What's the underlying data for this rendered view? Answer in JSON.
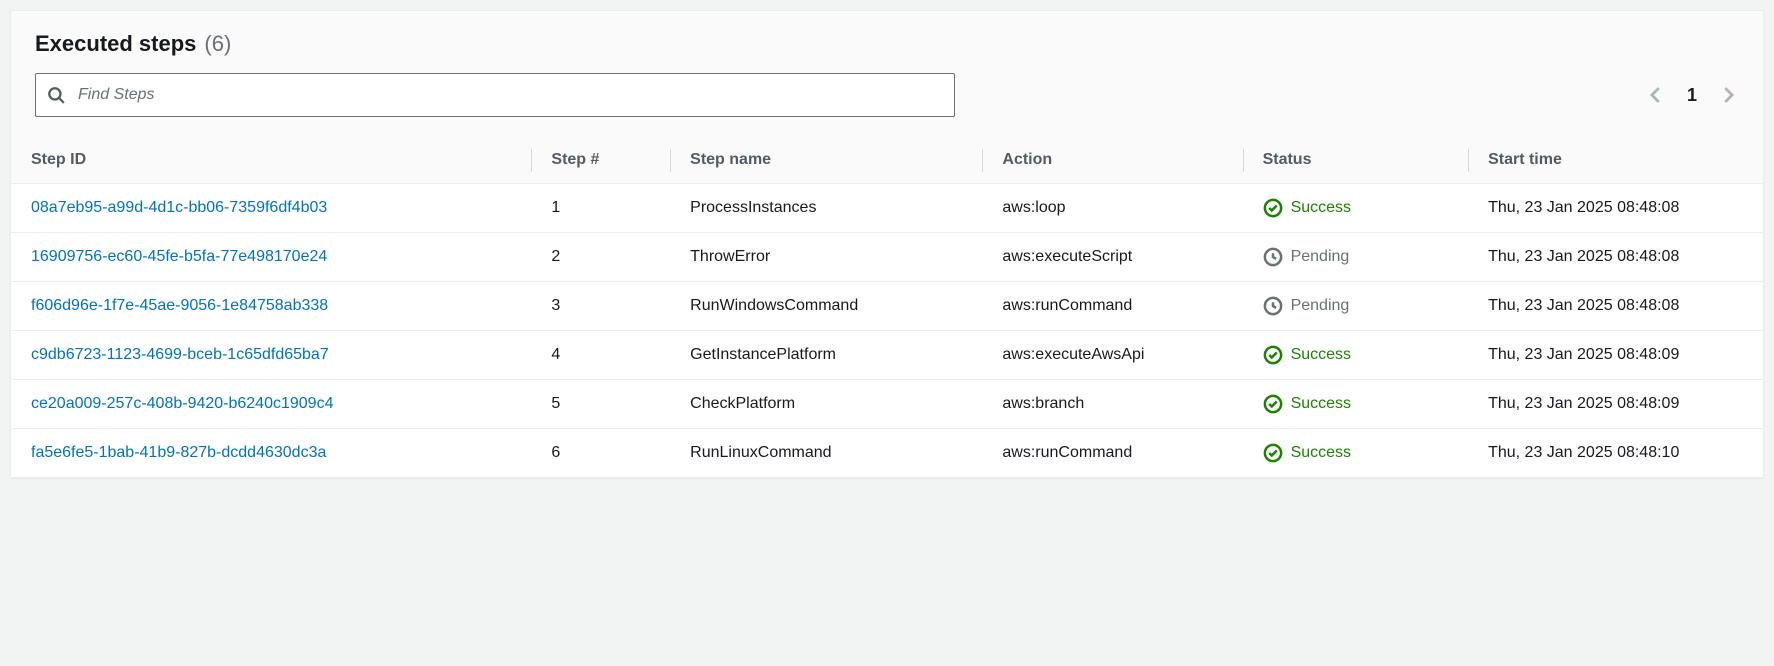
{
  "header": {
    "title": "Executed steps",
    "count": "(6)"
  },
  "search": {
    "placeholder": "Find Steps"
  },
  "pagination": {
    "current": "1"
  },
  "columns": {
    "step_id": "Step ID",
    "step_num": "Step #",
    "step_name": "Step name",
    "action": "Action",
    "status": "Status",
    "start_time": "Start time"
  },
  "status_labels": {
    "success": "Success",
    "pending": "Pending"
  },
  "rows": [
    {
      "id": "08a7eb95-a99d-4d1c-bb06-7359f6df4b03",
      "num": "1",
      "name": "ProcessInstances",
      "action": "aws:loop",
      "status": "success",
      "time": "Thu, 23 Jan 2025 08:48:08"
    },
    {
      "id": "16909756-ec60-45fe-b5fa-77e498170e24",
      "num": "2",
      "name": "ThrowError",
      "action": "aws:executeScript",
      "status": "pending",
      "time": "Thu, 23 Jan 2025 08:48:08"
    },
    {
      "id": "f606d96e-1f7e-45ae-9056-1e84758ab338",
      "num": "3",
      "name": "RunWindowsCommand",
      "action": "aws:runCommand",
      "status": "pending",
      "time": "Thu, 23 Jan 2025 08:48:08"
    },
    {
      "id": "c9db6723-1123-4699-bceb-1c65dfd65ba7",
      "num": "4",
      "name": "GetInstancePlatform",
      "action": "aws:executeAwsApi",
      "status": "success",
      "time": "Thu, 23 Jan 2025 08:48:09"
    },
    {
      "id": "ce20a009-257c-408b-9420-b6240c1909c4",
      "num": "5",
      "name": "CheckPlatform",
      "action": "aws:branch",
      "status": "success",
      "time": "Thu, 23 Jan 2025 08:48:09"
    },
    {
      "id": "fa5e6fe5-1bab-41b9-827b-dcdd4630dc3a",
      "num": "6",
      "name": "RunLinuxCommand",
      "action": "aws:runCommand",
      "status": "success",
      "time": "Thu, 23 Jan 2025 08:48:10"
    }
  ]
}
